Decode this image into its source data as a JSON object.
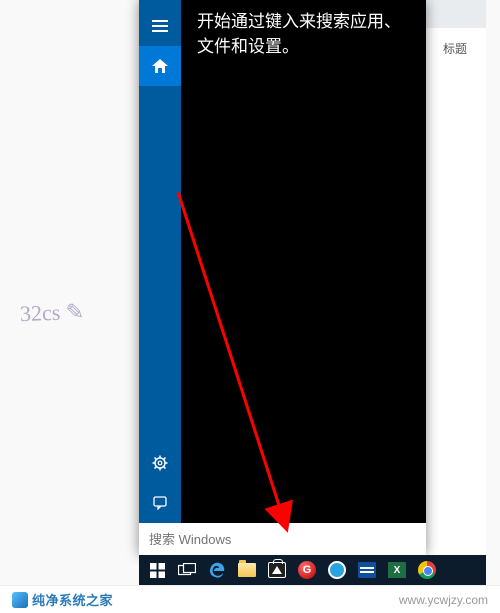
{
  "watermark_left": "32cs ✎",
  "background_window": {
    "header_label": "标题"
  },
  "search_flyout": {
    "hint_text": "开始通过键入来搜索应用、文件和设置。",
    "rail": {
      "hamburger_name": "hamburger-icon",
      "home_name": "home-icon",
      "gear_name": "gear-icon",
      "feedback_name": "feedback-icon"
    },
    "search_placeholder": "搜索 Windows"
  },
  "taskbar": {
    "items": [
      {
        "name": "start-button"
      },
      {
        "name": "task-view-button"
      },
      {
        "name": "edge-browser"
      },
      {
        "name": "file-explorer"
      },
      {
        "name": "microsoft-store"
      },
      {
        "name": "red-app"
      },
      {
        "name": "internet-explorer"
      },
      {
        "name": "calendar-app"
      },
      {
        "name": "excel-app"
      },
      {
        "name": "chrome-browser"
      }
    ],
    "red_app_glyph": "G",
    "excel_glyph": "X"
  },
  "footer": {
    "brand": "纯净系统之家",
    "url": "www.ycwjzy.com"
  }
}
